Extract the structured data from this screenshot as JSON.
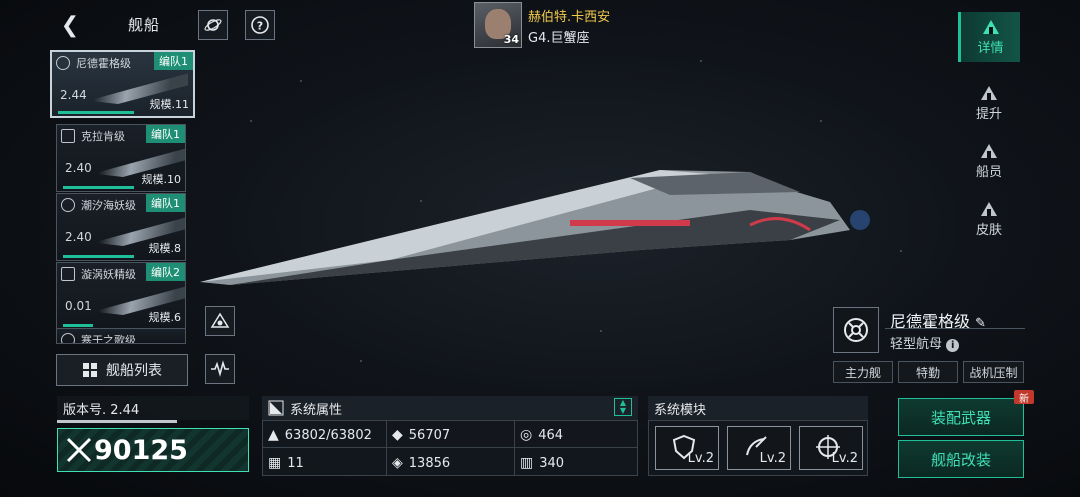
{
  "header": {
    "back_icon": "chevron-left-icon",
    "title": "舰船"
  },
  "commander": {
    "name": "赫伯特.卡西安",
    "rank": "G4.巨蟹座",
    "level": "34"
  },
  "ship_list": [
    {
      "name": "尼德霍格级",
      "fleet": "编队1",
      "stat": "2.44",
      "scale": "规模.11",
      "selected": true,
      "fill": 0.95
    },
    {
      "name": "克拉肯级",
      "fleet": "编队1",
      "stat": "2.40",
      "scale": "规模.10",
      "selected": false,
      "fill": 0.95
    },
    {
      "name": "潮汐海妖级",
      "fleet": "编队1",
      "stat": "2.40",
      "scale": "规模.8",
      "selected": false,
      "fill": 0.95
    },
    {
      "name": "漩涡妖精级",
      "fleet": "编队2",
      "stat": "0.01",
      "scale": "规模.6",
      "selected": false,
      "fill": 0.4
    },
    {
      "name": "寒于之歌级",
      "fleet": "",
      "stat": "",
      "scale": "",
      "selected": false,
      "fill": 0
    }
  ],
  "list_button": "舰船列表",
  "side_tabs": [
    {
      "label": "详情",
      "icon": "detail-icon",
      "active": true
    },
    {
      "label": "提升",
      "icon": "upgrade-icon",
      "active": false
    },
    {
      "label": "船员",
      "icon": "crew-icon",
      "active": false
    },
    {
      "label": "皮肤",
      "icon": "skin-icon",
      "active": false
    }
  ],
  "ship_info": {
    "name": "尼德霍格级",
    "class": "轻型航母",
    "tags": [
      "主力舰",
      "特勤",
      "战机压制"
    ]
  },
  "version": "版本号. 2.44",
  "power": "90125",
  "attributes": {
    "title": "系统属性",
    "items": [
      {
        "icon": "armor-icon",
        "value": "63802/63802"
      },
      {
        "icon": "firepower-icon",
        "value": "56707"
      },
      {
        "icon": "shield-icon",
        "value": "464"
      },
      {
        "icon": "checker-icon",
        "value": "11"
      },
      {
        "icon": "target-icon",
        "value": "13856"
      },
      {
        "icon": "speed-icon",
        "value": "340"
      }
    ]
  },
  "modules": {
    "title": "系统模块",
    "items": [
      {
        "icon": "shield-module-icon",
        "level": "Lv.2"
      },
      {
        "icon": "hangar-module-icon",
        "level": "Lv.2"
      },
      {
        "icon": "targeting-module-icon",
        "level": "Lv.2"
      }
    ]
  },
  "actions": {
    "equip": "装配武器",
    "modify": "舰船改装",
    "new_badge": "新"
  }
}
